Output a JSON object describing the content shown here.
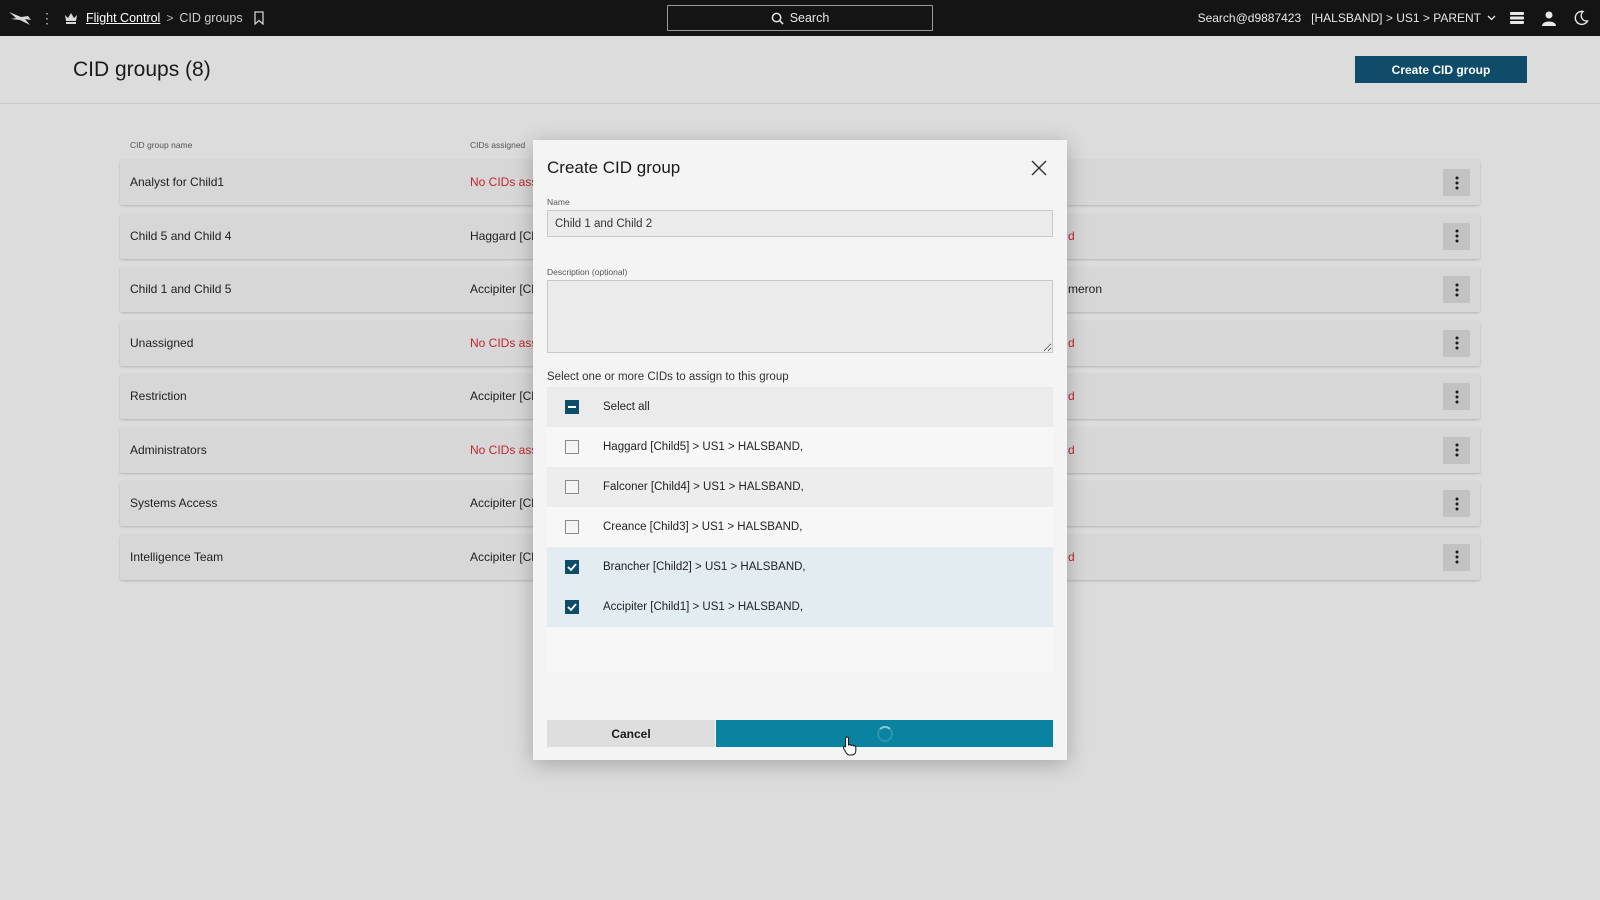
{
  "topbar": {
    "breadcrumb_link": "Flight Control",
    "breadcrumb_sep": ">",
    "breadcrumb_current": "CID groups",
    "search_label": "Search",
    "user": "Search@d9887423",
    "environment": "[HALSBAND] > US1 > PARENT"
  },
  "page": {
    "title": "CID groups (8)",
    "create_button": "Create CID group"
  },
  "table": {
    "columns": {
      "name": "CID group name",
      "assigned": "CIDs assigned"
    },
    "rows": [
      {
        "name": "Analyst for Child1",
        "assigned": "No CIDs assi",
        "members": ""
      },
      {
        "name": "Child 5 and Child 4",
        "assigned": "Haggard [Ch",
        "members": "d"
      },
      {
        "name": "Child 1 and Child 5",
        "assigned": "Accipiter [Cl",
        "members": "meron"
      },
      {
        "name": "Unassigned",
        "assigned": "No CIDs assi",
        "members": "d"
      },
      {
        "name": "Restriction",
        "assigned": "Accipiter [Cl",
        "members": "d"
      },
      {
        "name": "Administrators",
        "assigned": "No CIDs assi",
        "members": "d"
      },
      {
        "name": "Systems Access",
        "assigned": "Accipiter [Cl",
        "members": ""
      },
      {
        "name": "Intelligence Team",
        "assigned": "Accipiter [Cl",
        "members": "d"
      }
    ]
  },
  "modal": {
    "title": "Create CID group",
    "name_label": "Name",
    "name_value": "Child 1 and Child 2",
    "description_label": "Description (optional)",
    "select_label": "Select one or more CIDs to assign to this group",
    "select_all": "Select all",
    "cids": [
      {
        "label": "Haggard [Child5] > US1 > HALSBAND,",
        "checked": false
      },
      {
        "label": "Falconer [Child4] > US1 > HALSBAND,",
        "checked": false
      },
      {
        "label": "Creance [Child3] > US1 > HALSBAND,",
        "checked": false
      },
      {
        "label": "Brancher [Child2] > US1 > HALSBAND,",
        "checked": true
      },
      {
        "label": "Accipiter [Child1] > US1 > HALSBAND,",
        "checked": true
      }
    ],
    "cancel": "Cancel"
  },
  "colors": {
    "topbar": "#141414",
    "primary": "#0f4c6a",
    "submit": "#0a83a1",
    "error_text": "#c0272d",
    "selected_row": "#e3ecf1"
  },
  "icons": {
    "logo": "falcon-logo-icon",
    "app": "crown-icon",
    "bookmark": "bookmark-icon",
    "search": "search-icon",
    "notifications": "stack-icon",
    "user": "user-icon",
    "theme": "moon-icon",
    "close": "close-icon",
    "row_menu": "kebab-icon"
  }
}
